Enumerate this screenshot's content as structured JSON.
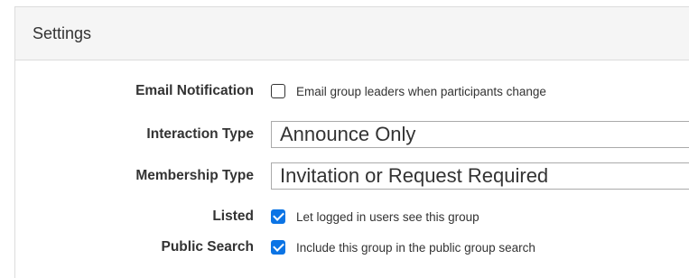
{
  "panel": {
    "title": "Settings"
  },
  "form": {
    "email_notification": {
      "label": "Email Notification",
      "checked": false,
      "text": "Email group leaders when participants change"
    },
    "interaction_type": {
      "label": "Interaction Type",
      "value": "Announce Only"
    },
    "membership_type": {
      "label": "Membership Type",
      "value": "Invitation or Request Required"
    },
    "listed": {
      "label": "Listed",
      "checked": true,
      "text": "Let logged in users see this group"
    },
    "public_search": {
      "label": "Public Search",
      "checked": true,
      "text": "Include this group in the public group search"
    }
  },
  "colors": {
    "checkbox_checked": "#0b74e5",
    "heading_bg": "#f5f5f5",
    "border": "#dcdcdc"
  }
}
